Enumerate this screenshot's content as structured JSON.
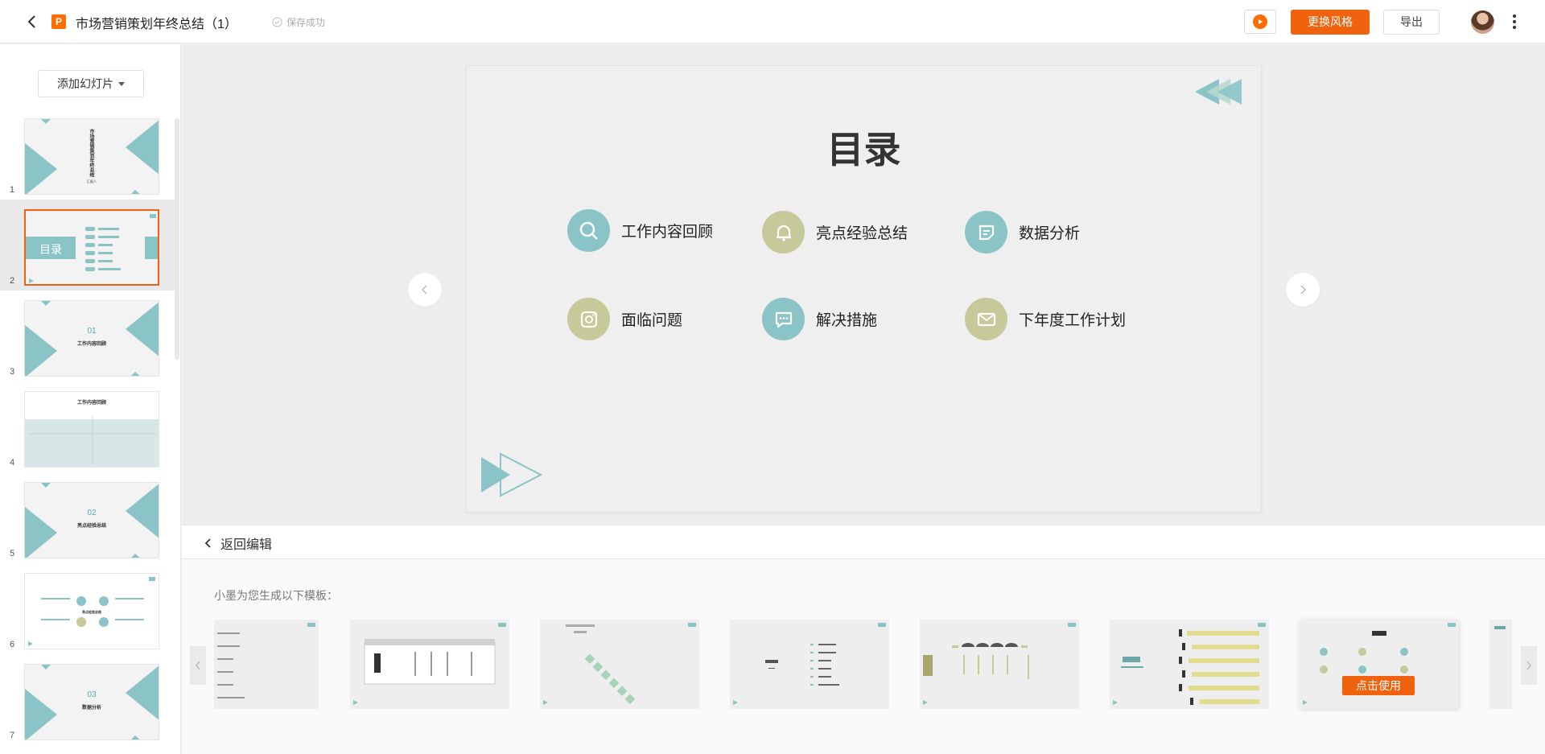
{
  "header": {
    "doc_title": "市场营销策划年终总结（1）",
    "save_status": "保存成功",
    "logo_letter": "P",
    "style_button": "更换风格",
    "export_button": "导出"
  },
  "sidebar": {
    "add_slide_button": "添加幻灯片",
    "slides": [
      {
        "num": "1",
        "title": "市场营销策划年终总结",
        "sub": "汇报人"
      },
      {
        "num": "2",
        "title": "目录",
        "sub": ""
      },
      {
        "num": "3",
        "title": "01",
        "sub": "工作内容回顾"
      },
      {
        "num": "4",
        "title": "工作内容回顾",
        "sub": ""
      },
      {
        "num": "5",
        "title": "02",
        "sub": "亮点经验总结"
      },
      {
        "num": "6",
        "title": "",
        "sub": "亮点经验总结"
      },
      {
        "num": "7",
        "title": "03",
        "sub": "数据分析"
      }
    ]
  },
  "slide": {
    "title": "目录",
    "items": [
      {
        "label": "工作内容回顾",
        "icon": "search-icon",
        "color": "#8bc4c6"
      },
      {
        "label": "亮点经验总结",
        "icon": "bell-icon",
        "color": "#c7c99a"
      },
      {
        "label": "数据分析",
        "icon": "note-icon",
        "color": "#8bc4c6"
      },
      {
        "label": "面临问题",
        "icon": "camera-icon",
        "color": "#c7c99a"
      },
      {
        "label": "解决措施",
        "icon": "chat-icon",
        "color": "#8bc4c6"
      },
      {
        "label": "下年度工作计划",
        "icon": "mail-icon",
        "color": "#c7c99a"
      }
    ]
  },
  "bottom": {
    "return_label": "返回编辑",
    "generated_label": "小墨为您生成以下模板：",
    "use_button": "点击使用",
    "templates": [
      {
        "name": "template-1"
      },
      {
        "name": "template-2"
      },
      {
        "name": "template-3"
      },
      {
        "name": "template-4"
      },
      {
        "name": "template-5"
      },
      {
        "name": "template-6"
      },
      {
        "name": "template-7"
      },
      {
        "name": "template-8"
      }
    ]
  },
  "colors": {
    "accent": "#f0620e",
    "teal": "#8bc4c6",
    "olive": "#c7c99a"
  }
}
